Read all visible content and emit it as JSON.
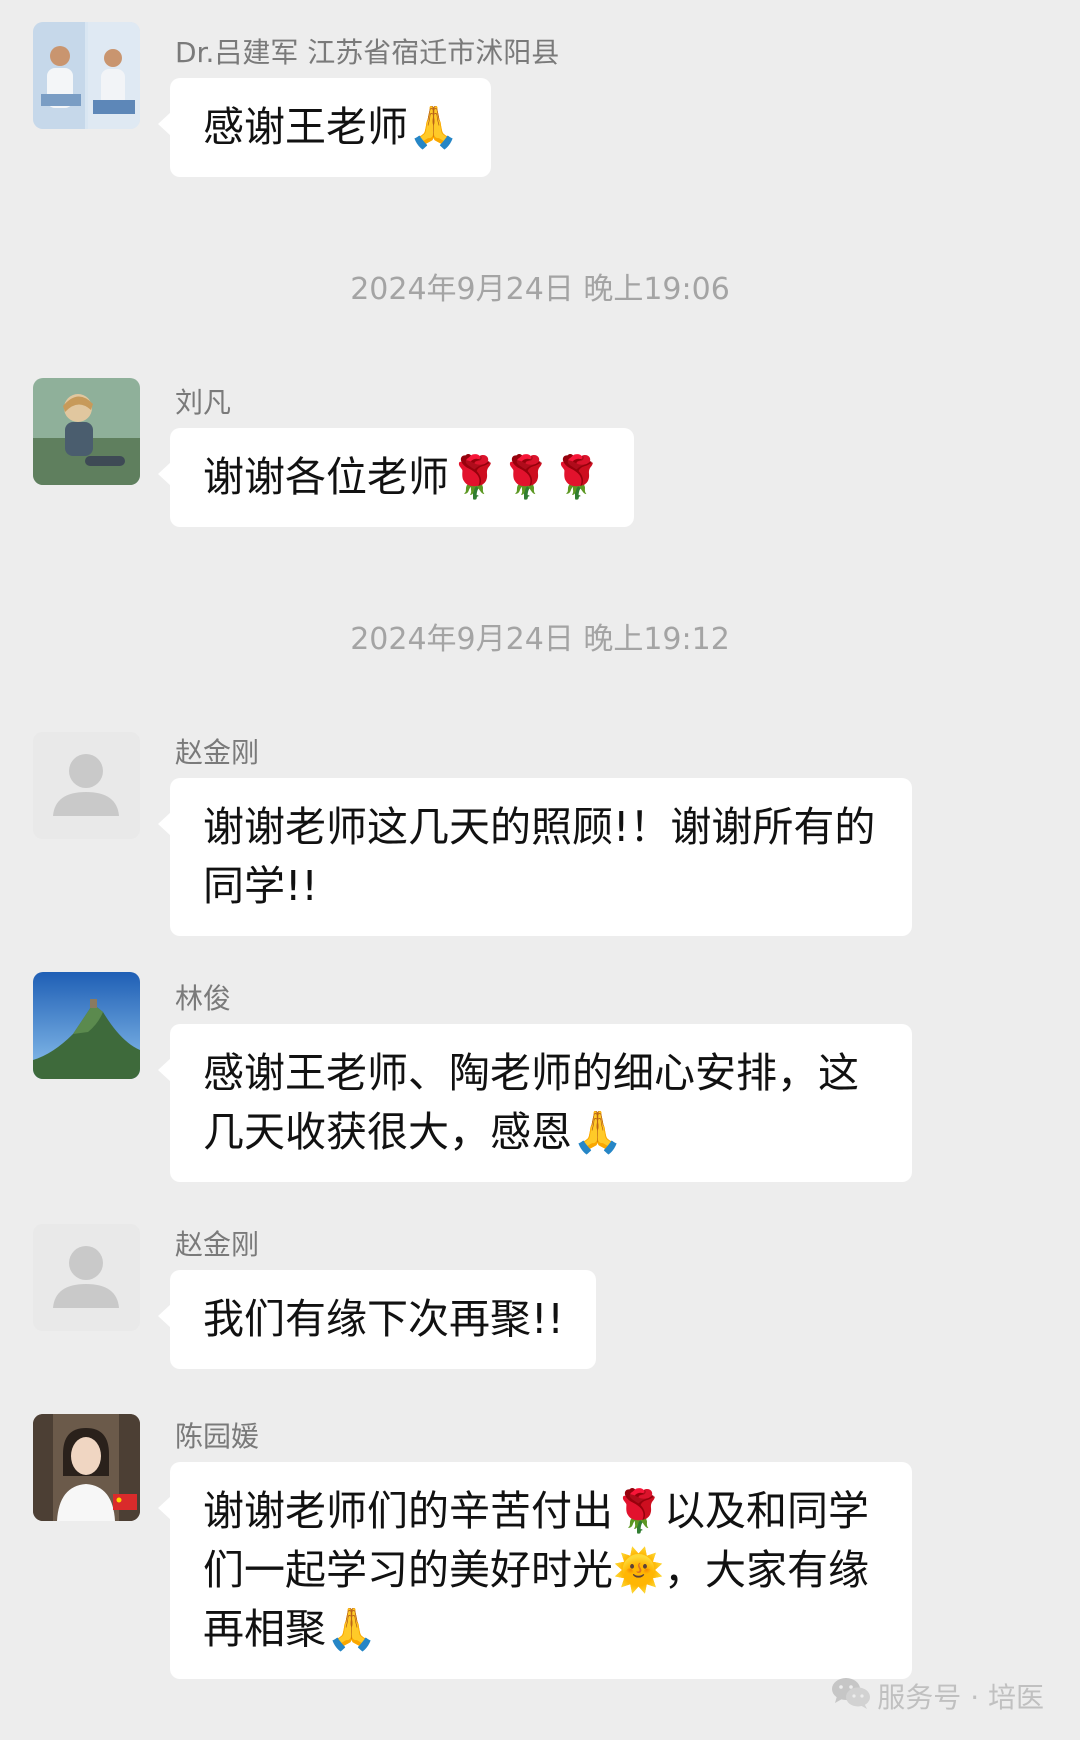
{
  "messages": [
    {
      "sender": "Dr.吕建军 江苏省宿迁市沭阳县",
      "text": "感谢王老师🙏",
      "avatar": "doctor-photo-avatar"
    },
    {
      "sender": "刘凡",
      "text": "谢谢各位老师🌹🌹🌹",
      "avatar": "child-photo-avatar"
    },
    {
      "sender": "赵金刚",
      "text": "谢谢老师这几天的照顾!！谢谢所有的同学!!",
      "avatar": "default-person-avatar"
    },
    {
      "sender": "林俊",
      "text": "感谢王老师、陶老师的细心安排，这几天收获很大，感恩🙏",
      "avatar": "mountain-photo-avatar"
    },
    {
      "sender": "赵金刚",
      "text": "我们有缘下次再聚!!",
      "avatar": "default-person-avatar"
    },
    {
      "sender": "陈园媛",
      "text": "谢谢老师们的辛苦付出🌹以及和同学们一起学习的美好时光🌞，大家有缘再相聚🙏",
      "avatar": "woman-photo-avatar"
    }
  ],
  "timestamps": [
    "2024年9月24日 晚上19:06",
    "2024年9月24日 晚上19:12"
  ],
  "watermark": {
    "text": "服务号 · 培医",
    "icon": "wechat-icon"
  },
  "colors": {
    "background": "#ededed",
    "bubble": "#ffffff",
    "meta_text": "#a4a4a4"
  }
}
